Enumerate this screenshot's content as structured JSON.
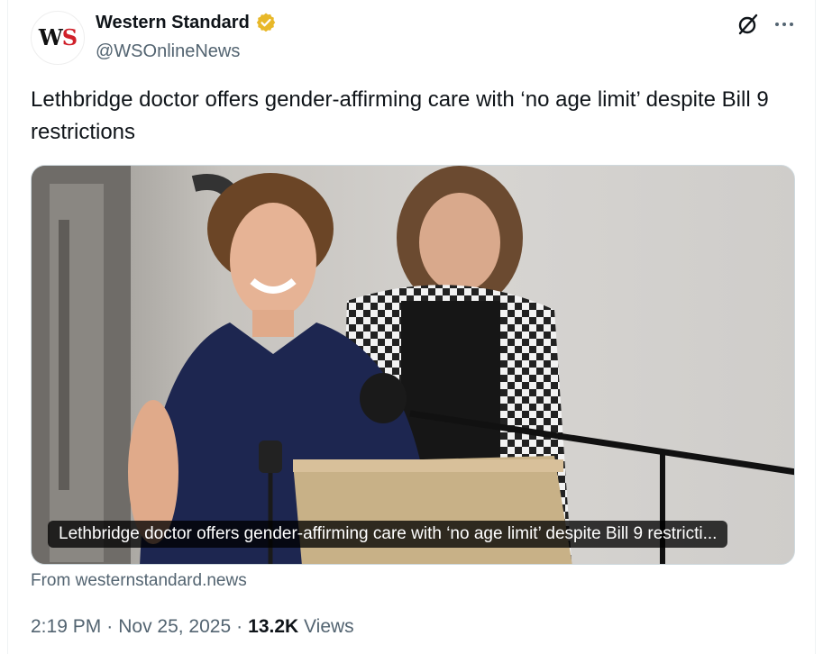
{
  "author": {
    "display_name": "Western Standard",
    "handle": "@WSOnlineNews",
    "avatar_logo_w": "W",
    "avatar_logo_s": "S",
    "verified_color": "#e8b829"
  },
  "tweet": {
    "text": "Lethbridge doctor offers gender-affirming care with ‘no age limit’ despite Bill 9 restrictions"
  },
  "media": {
    "caption": "Lethbridge doctor offers gender-affirming care with ‘no age limit’ despite Bill 9 restricti...",
    "source": "From westernstandard.news"
  },
  "meta": {
    "time": "2:19 PM",
    "separator1": "·",
    "date": "Nov 25, 2025",
    "separator2": "·",
    "views_count": "13.2K",
    "views_label": "Views"
  },
  "icons": {
    "grok": "grok-icon",
    "more": "more-icon",
    "verified": "verified-badge-icon"
  }
}
